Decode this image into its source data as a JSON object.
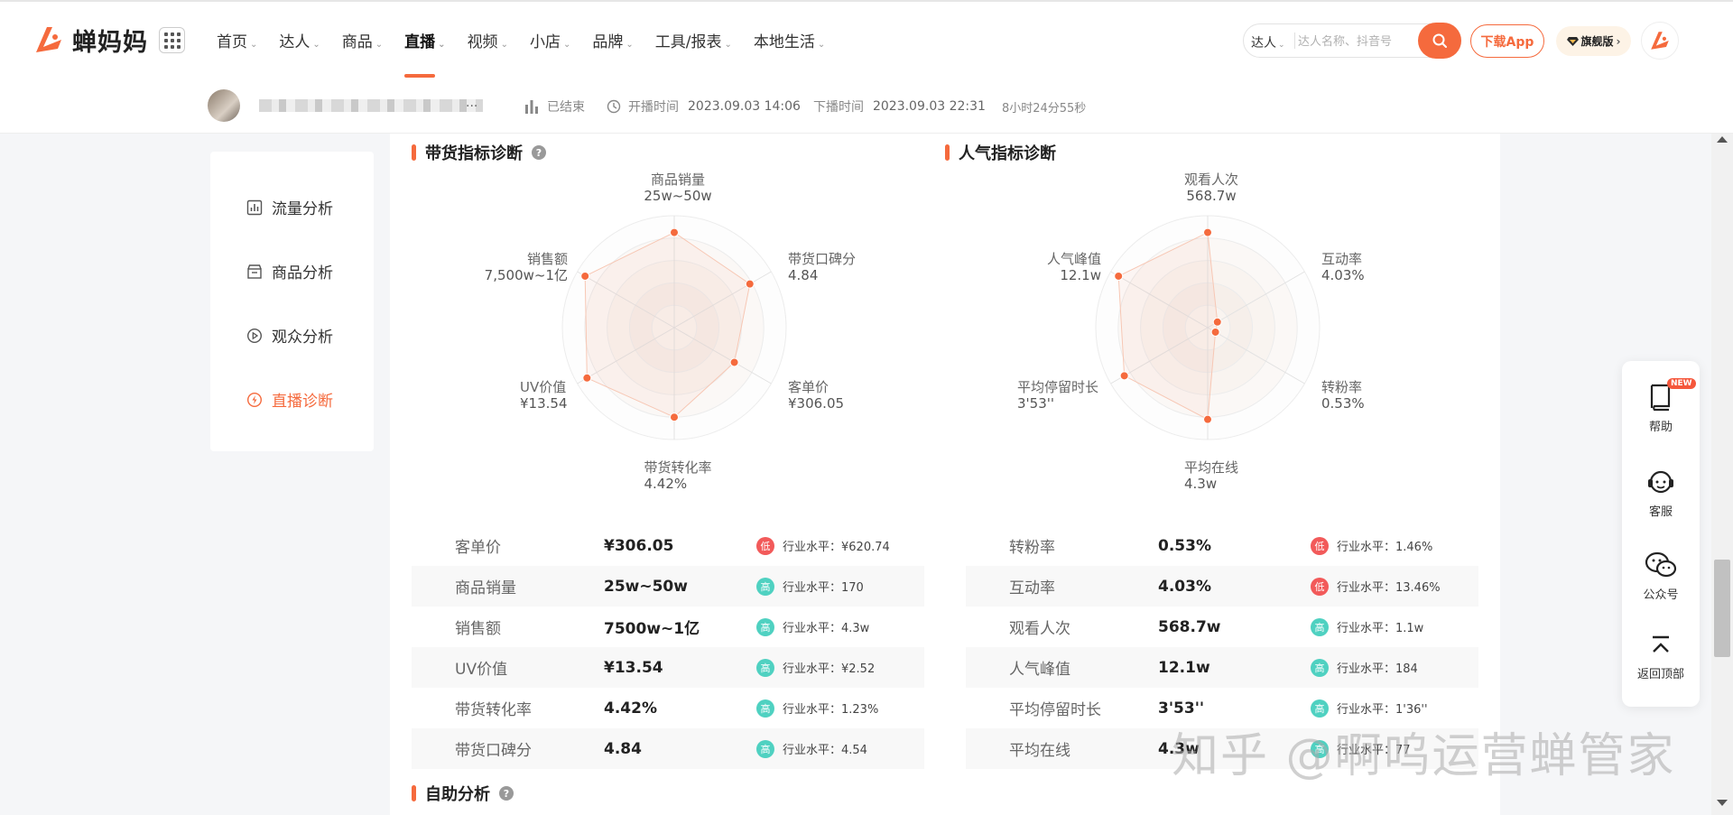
{
  "brand": {
    "name": "蝉妈妈",
    "accent": "#f56a3d"
  },
  "nav": {
    "items": [
      {
        "label": "首页"
      },
      {
        "label": "达人"
      },
      {
        "label": "商品"
      },
      {
        "label": "直播"
      },
      {
        "label": "视频"
      },
      {
        "label": "小店"
      },
      {
        "label": "品牌"
      },
      {
        "label": "工具/报表"
      },
      {
        "label": "本地生活"
      }
    ],
    "active": "直播",
    "chevron": "⌄"
  },
  "search": {
    "type": "达人",
    "placeholder": "达人名称、抖音号"
  },
  "header_buttons": {
    "download": "下载App",
    "flagship": "旗舰版"
  },
  "live": {
    "name_dots": "...",
    "status": "已结束",
    "start_label": "开播时间",
    "start_time": "2023.09.03 14:06",
    "end_label": "下播时间",
    "end_time": "2023.09.03 22:31",
    "duration": "8小时24分55秒"
  },
  "sidebar": {
    "items": [
      {
        "label": "流量分析",
        "icon": "bar-chart-icon"
      },
      {
        "label": "商品分析",
        "icon": "shop-icon"
      },
      {
        "label": "观众分析",
        "icon": "play-circle-icon"
      },
      {
        "label": "直播诊断",
        "icon": "lightning-circle-icon"
      }
    ],
    "active": "直播诊断"
  },
  "sections": {
    "sales": "带货指标诊断",
    "popularity": "人气指标诊断",
    "self_analysis": "自助分析",
    "help_glyph": "?"
  },
  "sales_radar": {
    "axes": [
      {
        "name": "商品销量",
        "value": "25w~50w",
        "level": 0.85
      },
      {
        "name": "带货口碑分",
        "value": "4.84",
        "level": 0.78
      },
      {
        "name": "客单价",
        "value": "¥306.05",
        "level": 0.62
      },
      {
        "name": "带货转化率",
        "value": "4.42%",
        "level": 0.8
      },
      {
        "name": "UV价值",
        "value": "¥13.54",
        "level": 0.9
      },
      {
        "name": "销售额",
        "value": "7,500w~1亿",
        "level": 0.92
      }
    ]
  },
  "popularity_radar": {
    "axes": [
      {
        "name": "观看人次",
        "value": "568.7w",
        "level": 0.85
      },
      {
        "name": "互动率",
        "value": "4.03%",
        "level": 0.1
      },
      {
        "name": "转粉率",
        "value": "0.53%",
        "level": 0.08
      },
      {
        "name": "平均在线",
        "value": "4.3w",
        "level": 0.82
      },
      {
        "name": "平均停留时长",
        "value": "3'53''",
        "level": 0.86
      },
      {
        "name": "人气峰值",
        "value": "12.1w",
        "level": 0.92
      }
    ]
  },
  "sales_table": [
    {
      "name": "客单价",
      "value": "¥306.05",
      "badge": "低",
      "level": "low",
      "industry": "行业水平：¥620.74"
    },
    {
      "name": "商品销量",
      "value": "25w~50w",
      "badge": "高",
      "level": "high",
      "industry": "行业水平：170"
    },
    {
      "name": "销售额",
      "value": "7500w~1亿",
      "badge": "高",
      "level": "high",
      "industry": "行业水平：4.3w"
    },
    {
      "name": "UV价值",
      "value": "¥13.54",
      "badge": "高",
      "level": "high",
      "industry": "行业水平：¥2.52"
    },
    {
      "name": "带货转化率",
      "value": "4.42%",
      "badge": "高",
      "level": "high",
      "industry": "行业水平：1.23%"
    },
    {
      "name": "带货口碑分",
      "value": "4.84",
      "badge": "高",
      "level": "high",
      "industry": "行业水平：4.54"
    }
  ],
  "popularity_table": [
    {
      "name": "转粉率",
      "value": "0.53%",
      "badge": "低",
      "level": "low",
      "industry": "行业水平：1.46%"
    },
    {
      "name": "互动率",
      "value": "4.03%",
      "badge": "低",
      "level": "low",
      "industry": "行业水平：13.46%"
    },
    {
      "name": "观看人次",
      "value": "568.7w",
      "badge": "高",
      "level": "high",
      "industry": "行业水平：1.1w"
    },
    {
      "name": "人气峰值",
      "value": "12.1w",
      "badge": "高",
      "level": "high",
      "industry": "行业水平：184"
    },
    {
      "name": "平均停留时长",
      "value": "3'53''",
      "badge": "高",
      "level": "high",
      "industry": "行业水平：1'36''"
    },
    {
      "name": "平均在线",
      "value": "4.3w",
      "badge": "高",
      "level": "high",
      "industry": "行业水平：77"
    }
  ],
  "float_bar": {
    "help": "帮助",
    "new_badge": "NEW",
    "service": "客服",
    "wechat": "公众号",
    "top": "返回顶部"
  },
  "watermark": "知乎 @啊呜运营蝉管家"
}
